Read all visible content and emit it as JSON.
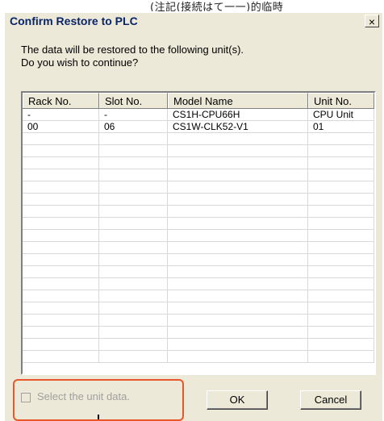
{
  "background_text": "(注記(接続はて一一)的临時",
  "dialog": {
    "title": "Confirm Restore to PLC",
    "close_glyph": "×",
    "message_line1": "The data will be restored to the following unit(s).",
    "message_line2": "Do you wish to continue?"
  },
  "table": {
    "columns": [
      "Rack No.",
      "Slot No.",
      "Model Name",
      "Unit No."
    ],
    "rows": [
      [
        "-",
        "-",
        "CS1H-CPU66H",
        "CPU Unit"
      ],
      [
        "00",
        "06",
        "CS1W-CLK52-V1",
        "01"
      ]
    ],
    "empty_row_count": 19
  },
  "footer": {
    "checkbox_label": "Select the unit data.",
    "checkbox_checked": false,
    "checkbox_enabled": false,
    "ok_label": "OK",
    "cancel_label": "Cancel",
    "highlight_color": "#e8562a"
  },
  "colors": {
    "title_text": "#0a246a",
    "dialog_bg": "#ece9d8"
  }
}
